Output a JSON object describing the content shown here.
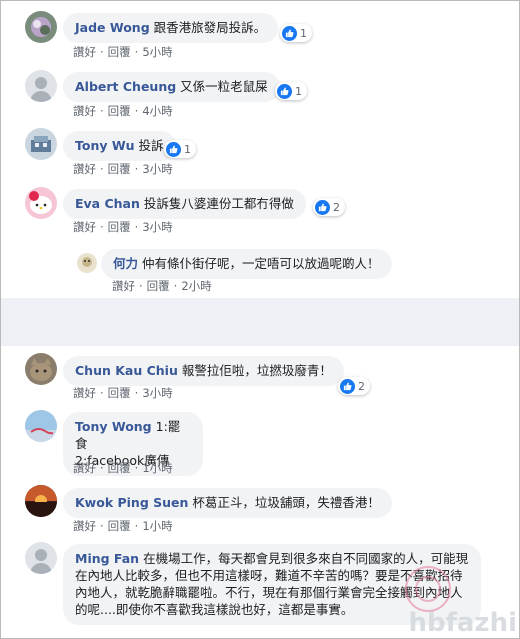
{
  "actions": {
    "like": "讚好",
    "reply": "回覆",
    "sep": "·"
  },
  "comments": [
    {
      "author": "Jade Wong",
      "text": "跟香港旅發局投訴。",
      "reactions": "1",
      "time": "5小時"
    },
    {
      "author": "Albert Cheung",
      "text": "又係一粒老鼠屎",
      "reactions": "1",
      "time": "4小時"
    },
    {
      "author": "Tony Wu",
      "text": "投訴",
      "reactions": "1",
      "time": "3小時"
    },
    {
      "author": "Eva Chan",
      "text": "投訴隻八婆連份工都冇得做",
      "reactions": "2",
      "time": "3小時"
    },
    {
      "author": "何力",
      "text": "仲有條仆街仔呢，一定唔可以放過呢啲人！",
      "time": "2小時"
    },
    {
      "author": "Chun Kau Chiu",
      "text": "報警拉佢啦，垃撚圾廢青！",
      "reactions": "2",
      "time": "3小時"
    },
    {
      "author": "Tony Wong",
      "text": "1:罷食",
      "text2": "2:facebook廣傳",
      "time": "1小時"
    },
    {
      "author": "Kwok Ping Suen",
      "text": "杯葛正斗，垃圾舖頭，失禮香港！",
      "time": "1小時"
    },
    {
      "author": "Ming Fan",
      "text": "在機場工作，每天都會見到很多來自不同國家的人，可能現在內地人比較多，但也不用這樣呀，難道不辛苦的嗎？要是不喜歡招待內地人，就乾脆辭職罷啦。不行，現在有那個行業會完全接觸到內地人的呢....即使你不喜歡我這樣說也好，這都是事實。"
    }
  ],
  "watermark": "hbfazhi",
  "colors": {
    "author": "#385898",
    "bubble": "#f2f3f5",
    "like": "#1877f2",
    "meta": "#606770"
  }
}
